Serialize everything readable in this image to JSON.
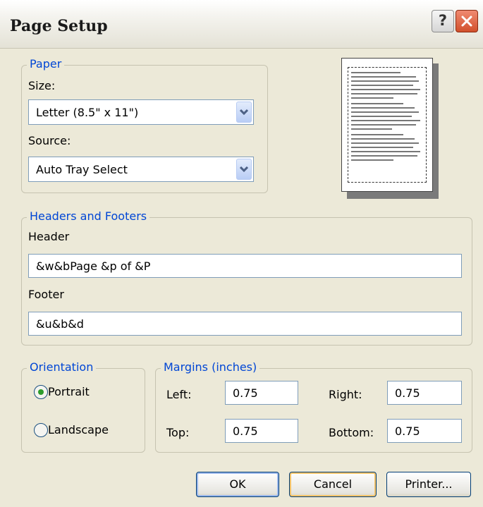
{
  "window": {
    "title": "Page Setup"
  },
  "titlebar": {
    "help_glyph": "?"
  },
  "paper": {
    "legend": "Paper",
    "size_label": "Size:",
    "size_value": "Letter (8.5\" x 11\")",
    "source_label": "Source:",
    "source_value": "Auto Tray Select"
  },
  "headers_footers": {
    "legend": "Headers and Footers",
    "header_label": "Header",
    "header_value": "&w&bPage &p of &P",
    "footer_label": "Footer",
    "footer_value": "&u&b&d"
  },
  "orientation": {
    "legend": "Orientation",
    "options": [
      {
        "label": "Portrait",
        "selected": true
      },
      {
        "label": "Landscape",
        "selected": false
      }
    ]
  },
  "margins": {
    "legend": "Margins (inches)",
    "left_label": "Left:",
    "left": "0.75",
    "right_label": "Right:",
    "right": "0.75",
    "top_label": "Top:",
    "top": "0.75",
    "bottom_label": "Bottom:",
    "bottom": "0.75"
  },
  "buttons": {
    "ok": "OK",
    "cancel": "Cancel",
    "printer": "Printer..."
  },
  "colors": {
    "legend": "#0046d5",
    "window_bg": "#ece9d8",
    "close": "#d1502c",
    "radio_dot": "#2c9c2c"
  },
  "icons": {
    "help": "question-mark",
    "close": "x",
    "dropdown": "chevron-down"
  }
}
